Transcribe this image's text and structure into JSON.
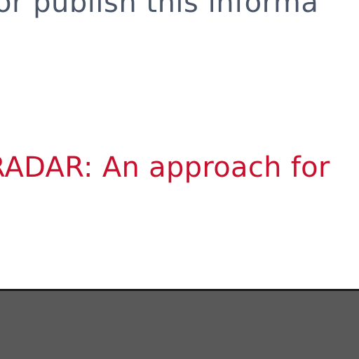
{
  "content": {
    "body_text": "or publish this informa",
    "paper_link": "RADAR: An approach for"
  },
  "colors": {
    "body_text": "#4a5568",
    "link": "#c8102e",
    "footer": "#595959",
    "divider": "#1a1a1a"
  }
}
